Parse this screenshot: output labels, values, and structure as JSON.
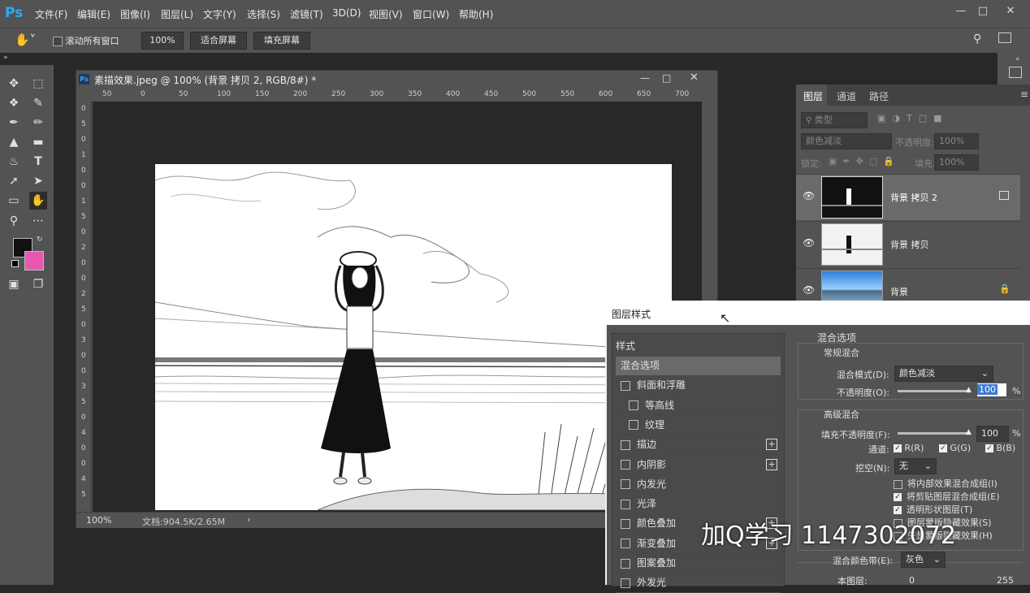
{
  "app": {
    "logo": "Ps"
  },
  "menu": [
    "文件(F)",
    "编辑(E)",
    "图像(I)",
    "图层(L)",
    "文字(Y)",
    "选择(S)",
    "滤镜(T)",
    "3D(D)",
    "视图(V)",
    "窗口(W)",
    "帮助(H)"
  ],
  "options": {
    "scroll_all": "滚动所有窗口",
    "zoom": "100%",
    "fit_screen": "适合屏幕",
    "fill_screen": "填充屏幕"
  },
  "document": {
    "title": "素描效果.jpeg @ 100% (背景 拷贝 2, RGB/8#) *",
    "zoom": "100%",
    "doc_info": "文档:904.5K/2.65M",
    "ruler_h": [
      "50",
      "0",
      "50",
      "100",
      "150",
      "200",
      "250",
      "300",
      "350",
      "400",
      "450",
      "500",
      "550",
      "600",
      "650",
      "700"
    ],
    "ruler_v": [
      "0",
      "5",
      "0",
      "1",
      "0",
      "0",
      "1",
      "5",
      "0",
      "2",
      "0",
      "0",
      "2",
      "5",
      "0",
      "3",
      "0",
      "0",
      "3",
      "5",
      "0",
      "4",
      "0",
      "0",
      "4",
      "5"
    ]
  },
  "layers_panel": {
    "tabs": [
      "图层",
      "通道",
      "路径"
    ],
    "filter_kind": "类型",
    "blend_mode": "颜色减淡",
    "opacity_label": "不透明度:",
    "opacity_value": "100%",
    "lock_label": "锁定:",
    "fill_label": "填充:",
    "fill_value": "100%",
    "layers": [
      {
        "name": "背景 拷贝 2"
      },
      {
        "name": "背景 拷贝"
      },
      {
        "name": "背景"
      }
    ]
  },
  "dialog": {
    "title": "图层样式",
    "styles_header": "样式",
    "styles": [
      {
        "label": "混合选项",
        "checkbox": false,
        "selected": true
      },
      {
        "label": "斜面和浮雕",
        "checkbox": true
      },
      {
        "label": "等高线",
        "checkbox": true,
        "indent": true
      },
      {
        "label": "纹理",
        "checkbox": true,
        "indent": true
      },
      {
        "label": "描边",
        "checkbox": true,
        "plus": true
      },
      {
        "label": "内阴影",
        "checkbox": true,
        "plus": true
      },
      {
        "label": "内发光",
        "checkbox": true
      },
      {
        "label": "光泽",
        "checkbox": true
      },
      {
        "label": "颜色叠加",
        "checkbox": true,
        "plus": true
      },
      {
        "label": "渐变叠加",
        "checkbox": true,
        "plus": true
      },
      {
        "label": "图案叠加",
        "checkbox": true
      },
      {
        "label": "外发光",
        "checkbox": true
      }
    ],
    "blend_options": "混合选项",
    "general_blend": "常规混合",
    "blend_mode_label": "混合模式(D):",
    "blend_mode_value": "颜色减淡",
    "opacity_label": "不透明度(O):",
    "opacity_value": "100",
    "pct": "%",
    "advanced_blend": "高级混合",
    "fill_opacity_label": "填充不透明度(F):",
    "fill_opacity_value": "100",
    "channels_label": "通道:",
    "channels": [
      "R(R)",
      "G(G)",
      "B(B)"
    ],
    "knockout_label": "挖空(N):",
    "knockout_value": "无",
    "advanced_opts": [
      {
        "label": "将内部效果混合成组(I)",
        "checked": false
      },
      {
        "label": "将剪贴图层混合成组(E)",
        "checked": true
      },
      {
        "label": "透明形状图层(T)",
        "checked": true
      },
      {
        "label": "图层蒙版隐藏效果(S)",
        "checked": false
      },
      {
        "label": "矢量蒙版隐藏效果(H)",
        "checked": false
      }
    ],
    "blend_if_label": "混合颜色带(E):",
    "blend_if_value": "灰色",
    "this_layer_label": "本图层:",
    "this_layer_min": "0",
    "this_layer_max": "255"
  },
  "watermark": "加Q学习  1147302072",
  "colors": {
    "foreground": "#111111",
    "background": "#e858b0",
    "accent": "#31a8ff"
  }
}
